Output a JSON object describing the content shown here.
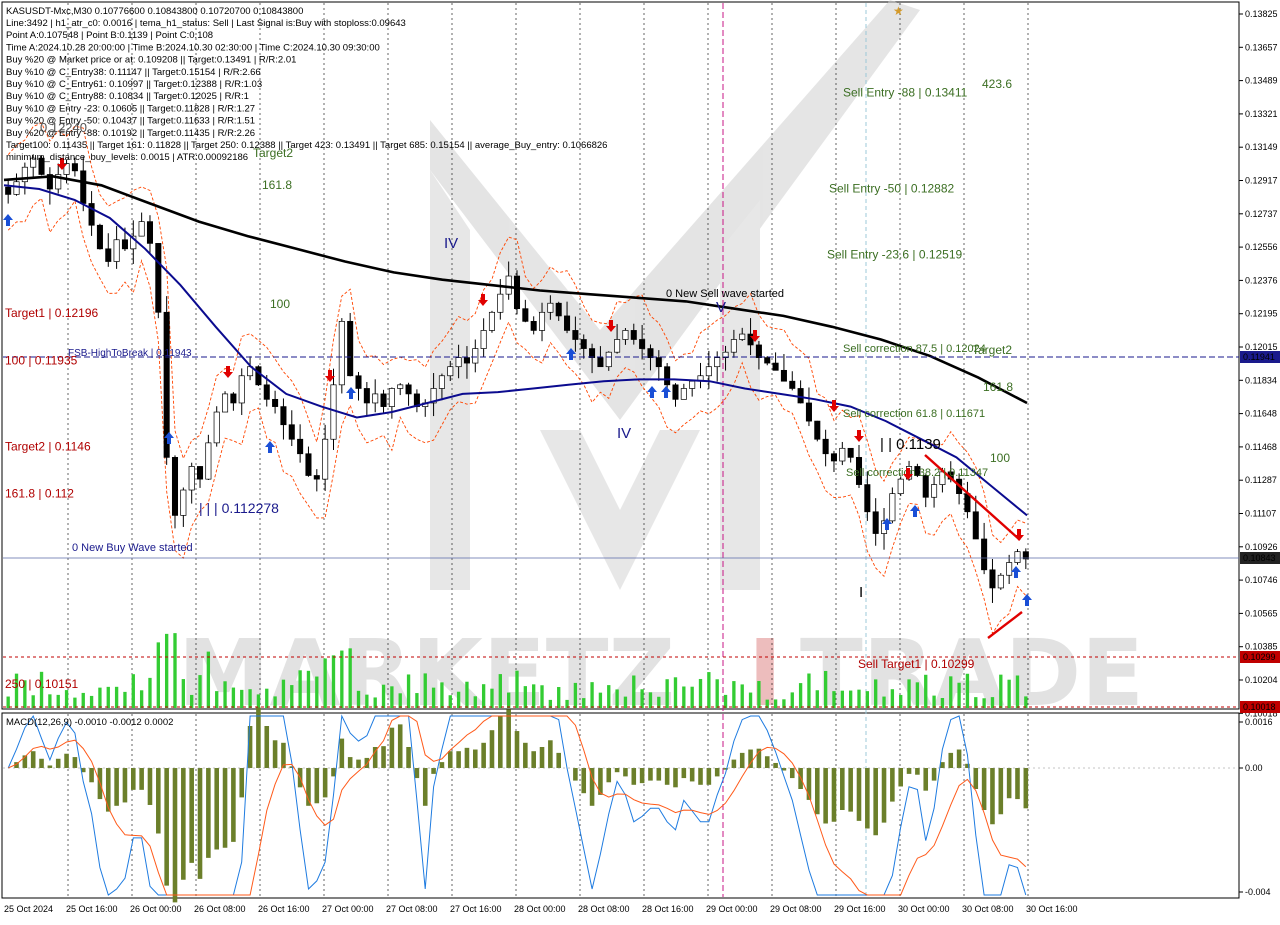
{
  "window": {
    "symbol_line": "KASUSDT-Mxc,M30  0.10776600 0.10843800 0.10720700 0.10843800"
  },
  "info_lines": [
    "Line:3492 | h1_atr_c0: 0.0016 | tema_h1_status: Sell | Last Signal is:Buy with stoploss:0.09643",
    "Point A:0.107548 | Point B:0.1139 | Point C:0.108",
    "Time A:2024.10.28 20:00:00 | Time B:2024.10.30 02:30:00 | Time C:2024.10.30 09:30:00",
    "Buy %20 @ Market price or at: 0.109208 || Target:0.13491 | R/R:2.01",
    "Buy %10 @ C_Entry38: 0.11147 || Target:0.15154 | R/R:2.66",
    "Buy %10 @ C_Entry61: 0.10997 || Target:0.12388 | R/R:1.03",
    "Buy %10 @ C_Entry88: 0.10834 || Target:0.12025 | R/R:1",
    "Buy %10 @ Entry -23: 0.10605 || Target:0.11828 | R/R:1.27",
    "Buy %20 @ Entry -50: 0.10437 || Target:0.11633 | R/R:1.51",
    "Buy %20 @ Entry -88: 0.10192 || Target:0.11435 | R/R:2.26",
    "Target100: 0.11435 || Target 161: 0.11828 || Target 250: 0.12388 || Target 423: 0.13491 || Target 685: 0.15154 || average_Buy_entry: 0.1066826",
    "minimum_distance_buy_levels: 0.0015 | ATR:0.00092186"
  ],
  "colors": {
    "background": "#ffffff",
    "candle": "#000000",
    "ma_fast": "#0b0b8f",
    "ma_slow": "#000000",
    "band": "#ff4500",
    "buy_arrow": "#1a4fd6",
    "sell_arrow": "#e00000",
    "level_blue": "#1a1a8c",
    "level_red": "#c00000",
    "label_green": "#3b6e22",
    "label_red": "#b00000",
    "volume": "#33cc33",
    "macd_hist": "#6b7f2a",
    "macd_line": "#1e7be0",
    "signal_line": "#ff5a1a",
    "magenta_vline": "#c71585",
    "watermark": "#d0d0d0",
    "watermark_red": "#e08080"
  },
  "watermark": {
    "left": "MARKETZ",
    "mid": "I",
    "right": "TRADE"
  },
  "price_axis": {
    "ticks": [
      "0.13825",
      "0.13657",
      "0.13489",
      "0.13321",
      "0.13149",
      "0.12917",
      "0.12737",
      "0.12556",
      "0.12376",
      "0.12195",
      "0.12015",
      "0.11834",
      "0.11648",
      "0.11468",
      "0.11287",
      "0.11107",
      "0.10926",
      "0.10746",
      "0.10565",
      "0.10385",
      "0.10204",
      "0.10018"
    ],
    "current_price": "0.10843",
    "highlight_level": "0.11941",
    "red_level": "0.10299"
  },
  "time_axis": {
    "labels": [
      "25 Oct 2024",
      "25 Oct 16:00",
      "26 Oct 00:00",
      "26 Oct 08:00",
      "26 Oct 16:00",
      "27 Oct 00:00",
      "27 Oct 08:00",
      "27 Oct 16:00",
      "28 Oct 00:00",
      "28 Oct 08:00",
      "28 Oct 16:00",
      "29 Oct 00:00",
      "29 Oct 08:00",
      "29 Oct 16:00",
      "30 Oct 00:00",
      "30 Oct 08:00",
      "30 Oct 16:00"
    ]
  },
  "macd": {
    "label": "MACD(12,26,9) -0.0010 -0.0012 0.0002",
    "ticks": [
      "0.0016",
      "0.00",
      "-0.004"
    ]
  },
  "annotations": {
    "fib_labels_left": [
      {
        "text": "Target1 | 0.12196",
        "price": 0.12196
      },
      {
        "text": "100 | 0.11935",
        "price": 0.11935
      },
      {
        "text": "Target2 | 0.1146",
        "price": 0.1146
      },
      {
        "text": "161.8 | 0.112",
        "price": 0.112
      },
      {
        "text": "250 | 0.10151",
        "price": 0.10151
      }
    ],
    "fsb": "FSB-HighToBreak | 0.11943",
    "new_buy_wave": "0 New Buy Wave started",
    "new_sell_wave": "0 New Sell wave started",
    "wave_low": "| | | 0.112278",
    "wave_b": "| | 0.1139",
    "wave_IV": "IV",
    "wave_V": "V",
    "wave_I": "I",
    "wave_IV2": "IV",
    "target2_top": "Target2",
    "fib_1618_top": "161.8",
    "fib_100_mid": "100",
    "sell_entries": [
      {
        "text": "Sell Entry -88 | 0.13411",
        "price": 0.13411
      },
      {
        "text": "Sell Entry -50 | 0.12882",
        "price": 0.12882
      },
      {
        "text": "Sell Entry -23.6 | 0.12519",
        "price": 0.12519
      }
    ],
    "sell_corrections": [
      {
        "text": "Sell correction 87.5 | 0.12024",
        "price": 0.12024
      },
      {
        "text": "Sell correction 61.8 | 0.11671",
        "price": 0.11671
      },
      {
        "text": "Sell correction 38.2 | 0.11347",
        "price": 0.11347
      }
    ],
    "right_labels": [
      {
        "text": "423.6",
        "price": 0.13491
      },
      {
        "text": "Target2",
        "price": 0.11941
      },
      {
        "text": "161.8",
        "price": 0.1182
      },
      {
        "text": "100",
        "price": 0.1143
      }
    ],
    "sell_target1": "Sell Target1 | 0.10299",
    "top_left_number": "0.12240",
    "target_c0": "Target2 0.12 | 0.12240"
  },
  "chart_data": {
    "type": "candlestick",
    "title": "KASUSDT-Mxc,M30",
    "ylim": [
      0.10018,
      0.139
    ],
    "series": [
      {
        "name": "close",
        "values": [
          0.1285,
          0.1292,
          0.13,
          0.1305,
          0.1296,
          0.1288,
          0.1296,
          0.1302,
          0.1298,
          0.128,
          0.1268,
          0.1255,
          0.1248,
          0.126,
          0.1255,
          0.1262,
          0.127,
          0.1258,
          0.122,
          0.114,
          0.1108,
          0.1122,
          0.1135,
          0.1128,
          0.1148,
          0.1165,
          0.1175,
          0.117,
          0.1185,
          0.119,
          0.118,
          0.1172,
          0.1168,
          0.1158,
          0.115,
          0.1142,
          0.113,
          0.1128,
          0.115,
          0.118,
          0.1215,
          0.1185,
          0.1178,
          0.117,
          0.1175,
          0.1168,
          0.1178,
          0.118,
          0.1175,
          0.1168,
          0.117,
          0.1178,
          0.1185,
          0.119,
          0.1195,
          0.1192,
          0.12,
          0.121,
          0.122,
          0.123,
          0.124,
          0.1222,
          0.1215,
          0.121,
          0.122,
          0.1225,
          0.1218,
          0.121,
          0.1205,
          0.12,
          0.1195,
          0.119,
          0.1198,
          0.1205,
          0.121,
          0.1205,
          0.12,
          0.1195,
          0.119,
          0.118,
          0.1172,
          0.1178,
          0.1182,
          0.1185,
          0.119,
          0.1195,
          0.1198,
          0.1205,
          0.1208,
          0.1202,
          0.1195,
          0.1192,
          0.1188,
          0.1182,
          0.1178,
          0.117,
          0.116,
          0.115,
          0.1142,
          0.1138,
          0.1145,
          0.114,
          0.1125,
          0.111,
          0.1098,
          0.1105,
          0.112,
          0.1128,
          0.1135,
          0.113,
          0.1118,
          0.1125,
          0.1132,
          0.1128,
          0.112,
          0.111,
          0.1095,
          0.1078,
          0.1068,
          0.1075,
          0.1082,
          0.1088,
          0.1084
        ]
      },
      {
        "name": "ma_fast",
        "values": [
          0.129,
          0.1288,
          0.1282,
          0.1272,
          0.1255,
          0.1235,
          0.1212,
          0.119,
          0.1175,
          0.1168,
          0.1162,
          0.1165,
          0.117,
          0.1175,
          0.1176,
          0.1178,
          0.118,
          0.1182,
          0.1183,
          0.1183,
          0.1182,
          0.1178,
          0.1175,
          0.1172,
          0.1168,
          0.116,
          0.115,
          0.114,
          0.1124,
          0.1108
        ]
      },
      {
        "name": "ma_slow",
        "values": [
          0.1293,
          0.1295,
          0.129,
          0.128,
          0.127,
          0.1262,
          0.1255,
          0.1248,
          0.1242,
          0.1238,
          0.1235,
          0.1232,
          0.123,
          0.1228,
          0.1226,
          0.1222,
          0.1218,
          0.1212,
          0.1205,
          0.1196,
          0.1184,
          0.117
        ]
      }
    ]
  }
}
